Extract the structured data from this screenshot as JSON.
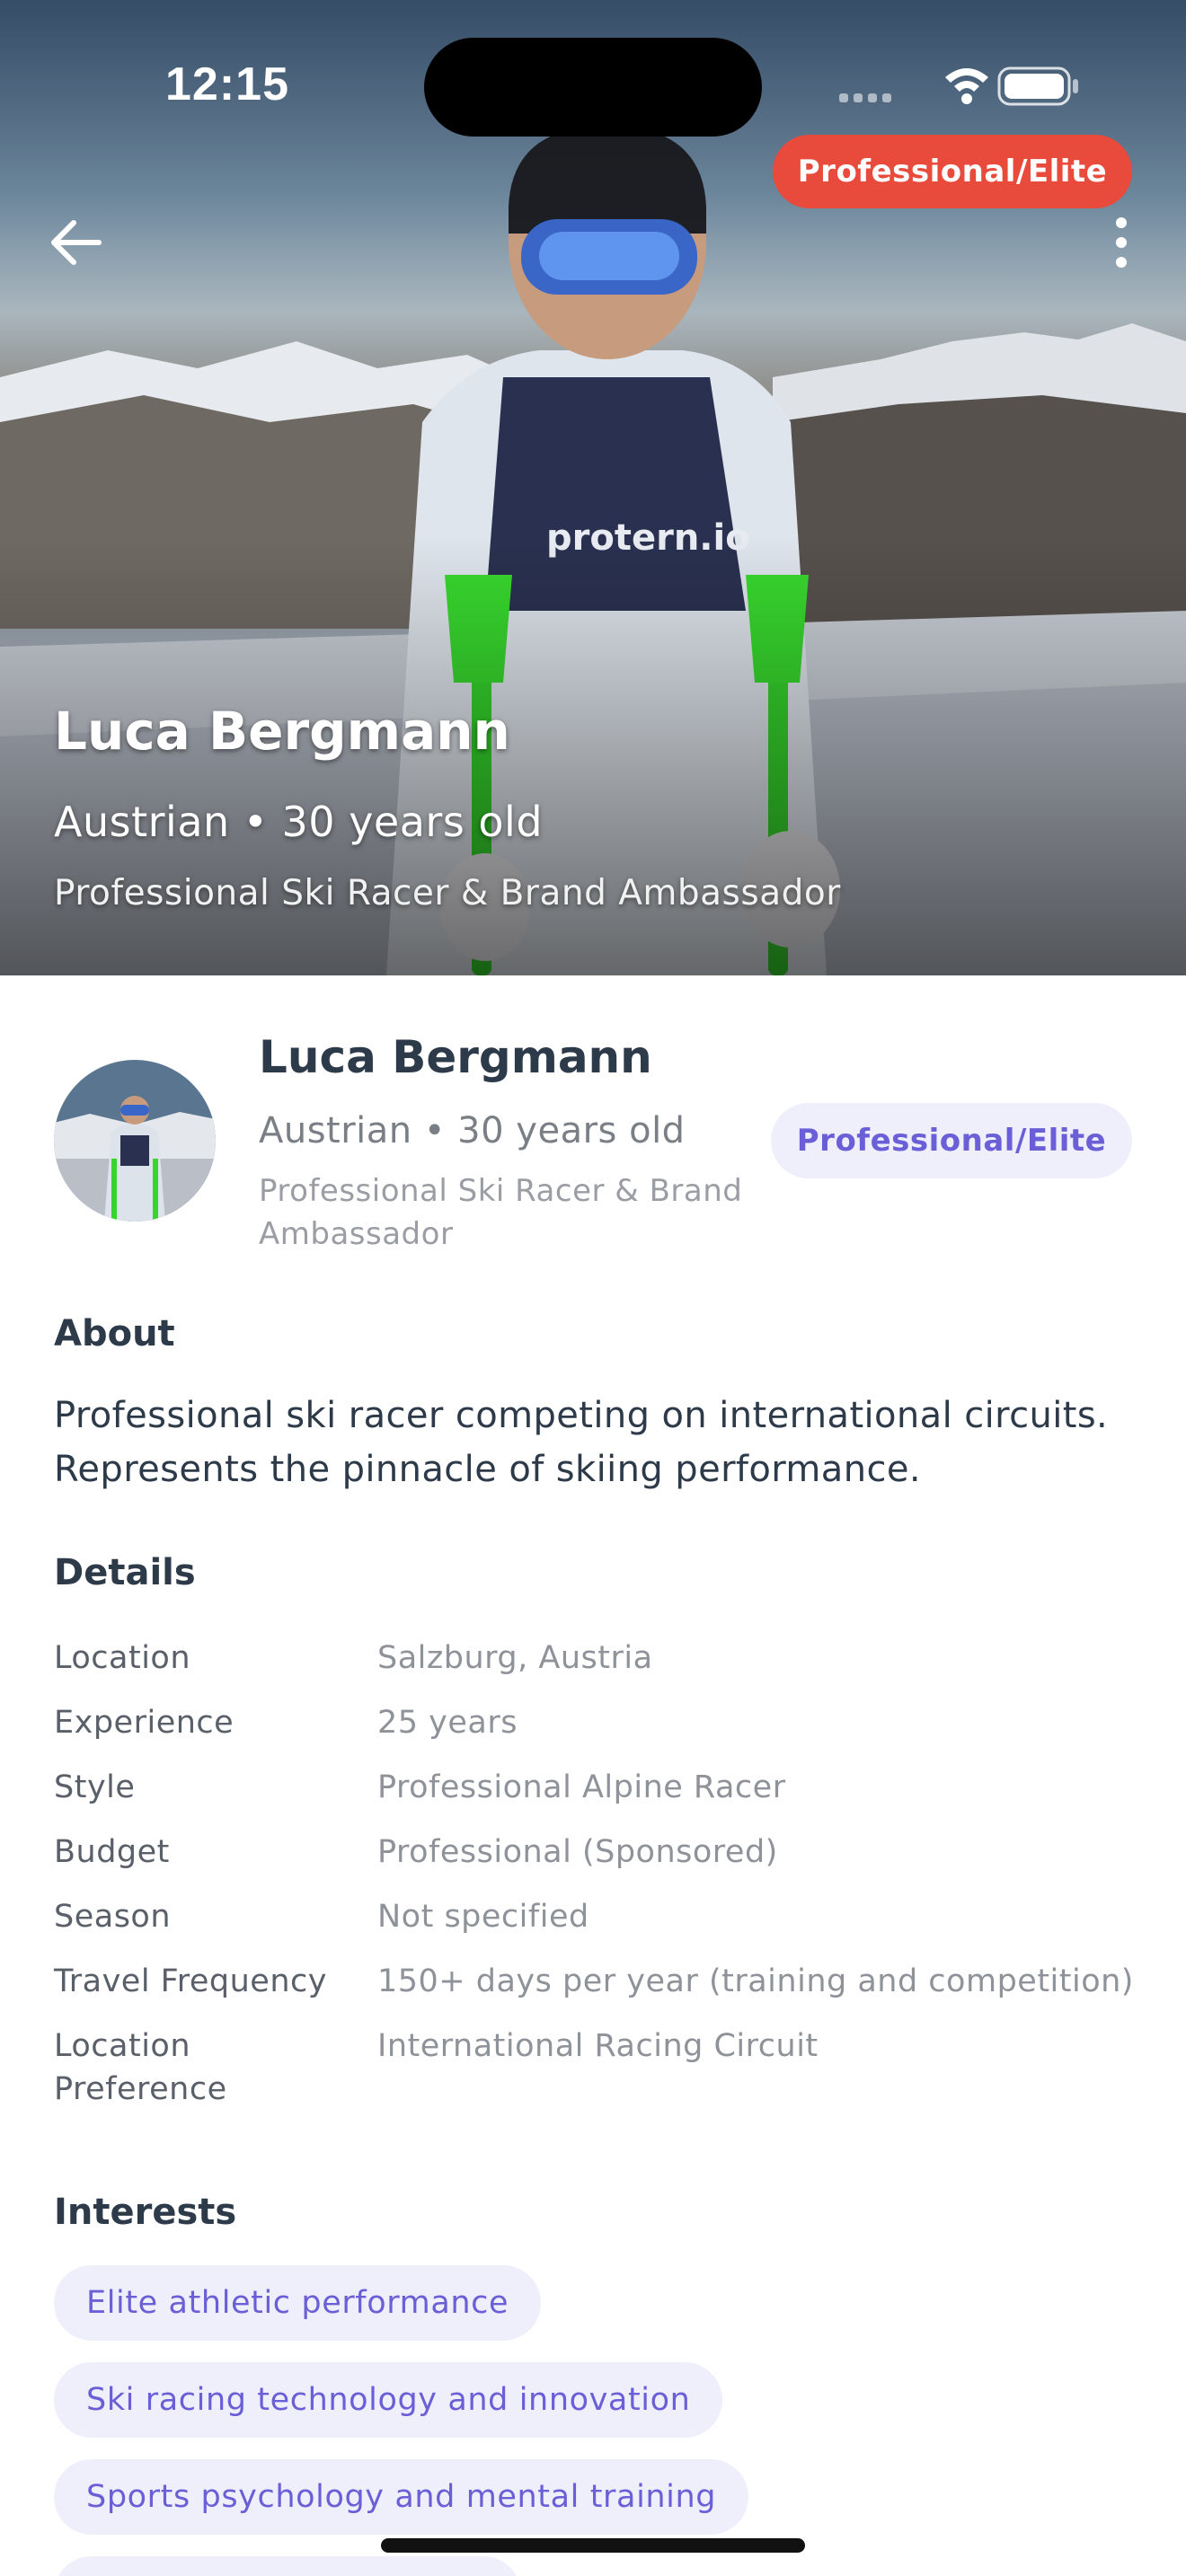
{
  "status_bar": {
    "time": "12:15"
  },
  "hero": {
    "badge": "Professional/Elite",
    "name": "Luca Bergmann",
    "meta": "Austrian • 30 years old",
    "role": "Professional Ski Racer & Brand Ambassador"
  },
  "profile": {
    "name": "Luca Bergmann",
    "meta": "Austrian • 30 years old",
    "role": "Professional Ski Racer & Brand Ambassador",
    "badge": "Professional/Elite"
  },
  "about": {
    "title": "About",
    "text": "Professional ski racer competing on international circuits. Represents the pinnacle of skiing performance."
  },
  "details": {
    "title": "Details",
    "rows": [
      {
        "label": "Location",
        "value": "Salzburg, Austria"
      },
      {
        "label": "Experience",
        "value": "25 years"
      },
      {
        "label": "Style",
        "value": "Professional Alpine Racer"
      },
      {
        "label": "Budget",
        "value": "Professional (Sponsored)"
      },
      {
        "label": "Season",
        "value": "Not specified"
      },
      {
        "label": "Travel Frequency",
        "value": "150+ days per year (training and competition)"
      },
      {
        "label": "Location Preference",
        "value": "International Racing Circuit"
      }
    ]
  },
  "interests": {
    "title": "Interests",
    "items": [
      "Elite athletic performance",
      "Ski racing technology and innovation",
      "Sports psychology and mental training"
    ]
  },
  "colors": {
    "hero_badge": "#e84a3c",
    "chip_bg": "#efeefb",
    "chip_text": "#6a5fd6",
    "text_dark": "#2d3a4a"
  },
  "icons": {
    "back": "arrow-left-icon",
    "more": "more-vertical-icon",
    "signal": "cellular-signal-icon",
    "wifi": "wifi-icon",
    "battery": "battery-icon"
  }
}
